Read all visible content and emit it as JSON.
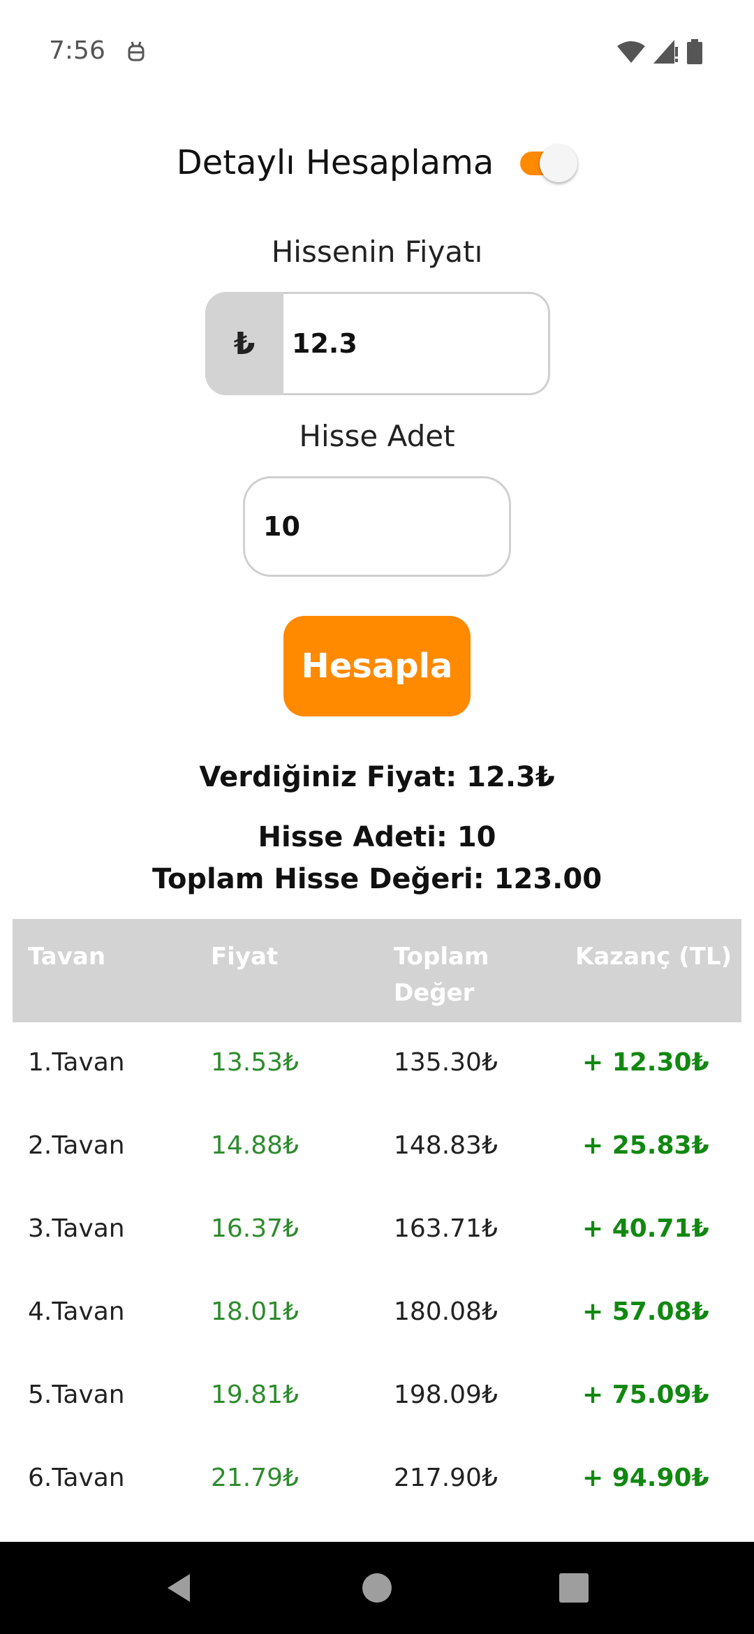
{
  "status_bar": {
    "time": "7:56",
    "left_icon": "android-debug-icon",
    "right_icons": [
      "wifi-icon",
      "cellular-signal-icon",
      "battery-icon"
    ]
  },
  "detail_toggle": {
    "label": "Detaylı Hesaplama",
    "checked": true
  },
  "price_field": {
    "label": "Hissenin Fiyatı",
    "prefix": "₺",
    "value": "12.3"
  },
  "quantity_field": {
    "label": "Hisse Adet",
    "value": "10"
  },
  "calculate_button": {
    "label": "Hesapla"
  },
  "results": {
    "given_price": "Verdiğiniz Fiyat: 12.3₺",
    "share_count": "Hisse Adeti: 10",
    "total_value": "Toplam Hisse Değeri: 123.00"
  },
  "table": {
    "headers": [
      "Tavan",
      "Fiyat",
      "Toplam Değer",
      "Kazanç (TL)"
    ],
    "rows": [
      [
        "1.Tavan",
        "13.53₺",
        "135.30₺",
        "+ 12.30₺"
      ],
      [
        "2.Tavan",
        "14.88₺",
        "148.83₺",
        "+ 25.83₺"
      ],
      [
        "3.Tavan",
        "16.37₺",
        "163.71₺",
        "+ 40.71₺"
      ],
      [
        "4.Tavan",
        "18.01₺",
        "180.08₺",
        "+ 57.08₺"
      ],
      [
        "5.Tavan",
        "19.81₺",
        "198.09₺",
        "+ 75.09₺"
      ],
      [
        "6.Tavan",
        "21.79₺",
        "217.90₺",
        "+ 94.90₺"
      ]
    ]
  },
  "nav_bar": {
    "buttons": [
      "back-icon",
      "home-icon",
      "recents-icon"
    ]
  },
  "colors": {
    "accent": "#ff8a00",
    "input_prefix_bg": "#d3d3d3",
    "table_header_bg": "#d3d3d3",
    "price_green": "#2e8b2e",
    "gain_green": "#118811"
  }
}
